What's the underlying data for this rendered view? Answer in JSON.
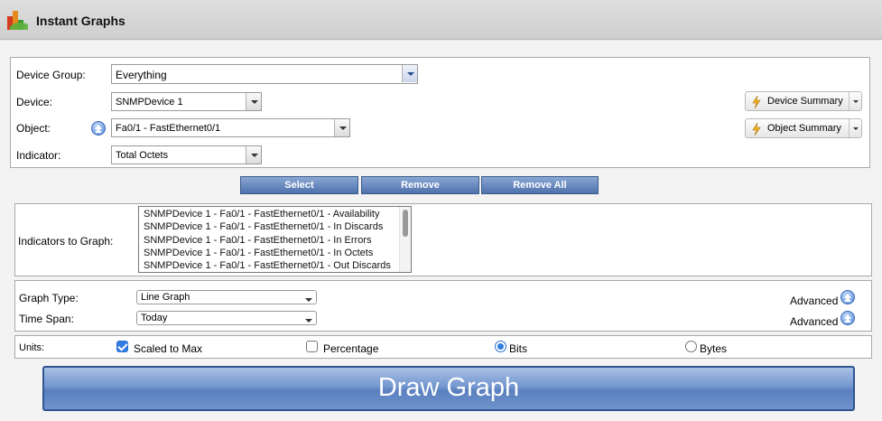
{
  "header": {
    "title": "Instant Graphs",
    "logo_icon": "bar-chart-logo-icon"
  },
  "selection": {
    "device_group_label": "Device Group:",
    "device_group_value": "Everything",
    "device_label": "Device:",
    "device_value": "SNMPDevice 1",
    "object_label": "Object:",
    "object_value": "Fa0/1 - FastEthernet0/1",
    "indicator_label": "Indicator:",
    "indicator_value": "Total Octets",
    "device_summary_label": "Device Summary",
    "object_summary_label": "Object Summary"
  },
  "actions": {
    "select": "Select",
    "remove": "Remove",
    "remove_all": "Remove All"
  },
  "indicators": {
    "label": "Indicators to Graph:",
    "items": [
      "SNMPDevice 1 - Fa0/1 - FastEthernet0/1 - Availability",
      "SNMPDevice 1 - Fa0/1 - FastEthernet0/1 - In Discards",
      "SNMPDevice 1 - Fa0/1 - FastEthernet0/1 - In Errors",
      "SNMPDevice 1 - Fa0/1 - FastEthernet0/1 - In Octets",
      "SNMPDevice 1 - Fa0/1 - FastEthernet0/1 - Out Discards"
    ]
  },
  "graph": {
    "type_label": "Graph Type:",
    "type_value": "Line Graph",
    "span_label": "Time Span:",
    "span_value": "Today",
    "advanced_label": "Advanced"
  },
  "units": {
    "label": "Units:",
    "scaled_label": "Scaled to Max",
    "scaled_checked": true,
    "percentage_label": "Percentage",
    "percentage_checked": false,
    "bits_label": "Bits",
    "bytes_label": "Bytes",
    "selected_unit": "Bits"
  },
  "draw_graph_label": "Draw Graph",
  "colors": {
    "accent": "#5a80bf",
    "button": "#4e72ad",
    "checked": "#2f7de1"
  }
}
